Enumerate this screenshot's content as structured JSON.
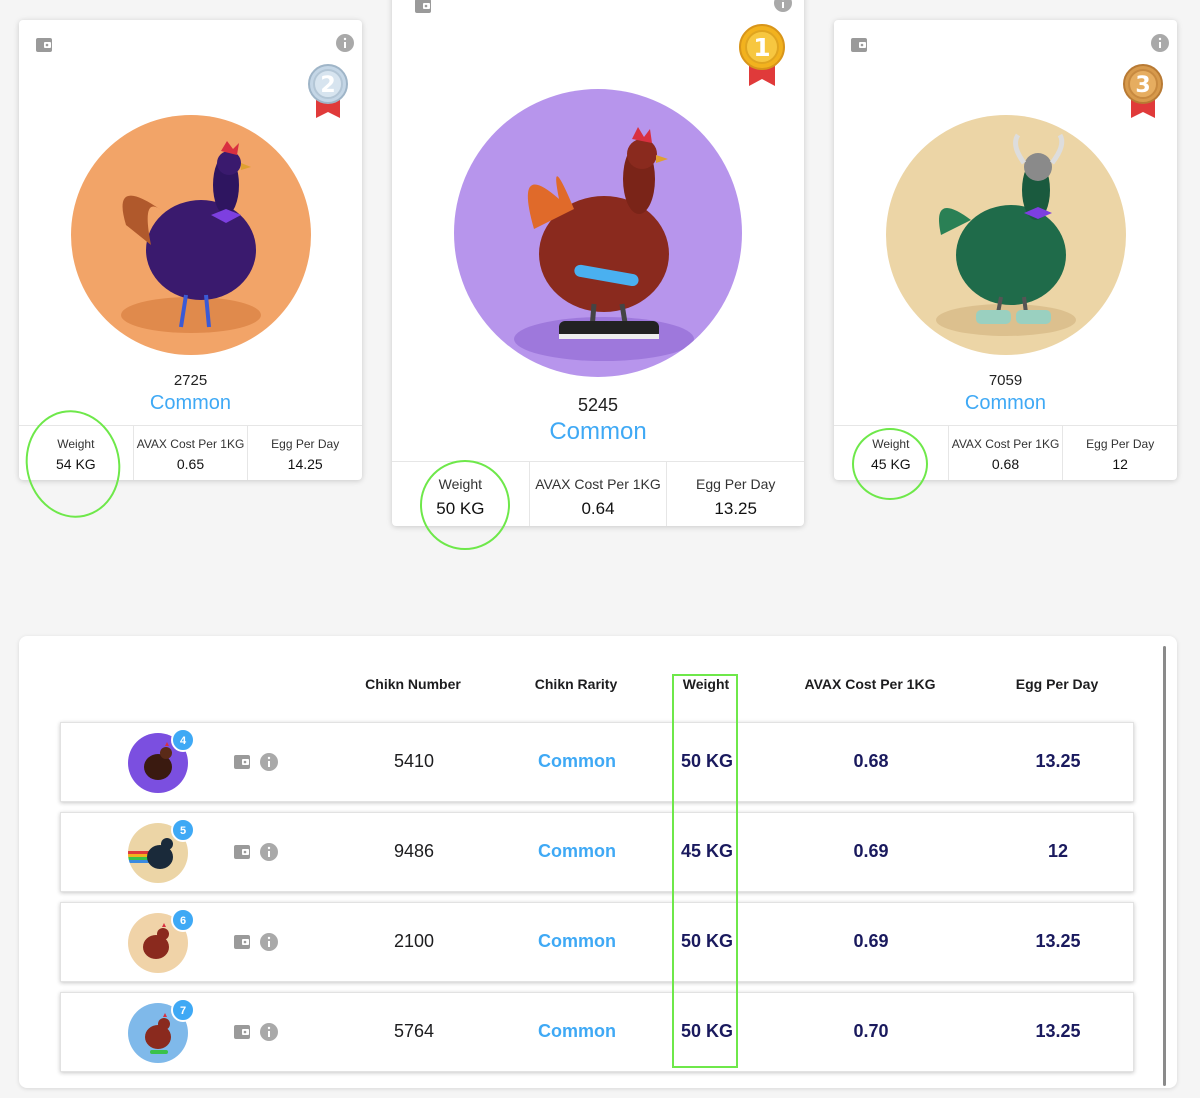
{
  "top_cards": [
    {
      "rank": "2",
      "chikn_number": "2725",
      "rarity": "Common",
      "stats": [
        {
          "label": "Weight",
          "value": "54 KG"
        },
        {
          "label": "AVAX Cost Per 1KG",
          "value": "0.65"
        },
        {
          "label": "Egg Per Day",
          "value": "14.25"
        }
      ],
      "circle_color": "#f2a468",
      "medal_color": "#c4d6e6"
    },
    {
      "rank": "1",
      "chikn_number": "5245",
      "rarity": "Common",
      "stats": [
        {
          "label": "Weight",
          "value": "50 KG"
        },
        {
          "label": "AVAX Cost Per 1KG",
          "value": "0.64"
        },
        {
          "label": "Egg Per Day",
          "value": "13.25"
        }
      ],
      "circle_color": "#b795ec",
      "medal_color": "#f2b21e"
    },
    {
      "rank": "3",
      "chikn_number": "7059",
      "rarity": "Common",
      "stats": [
        {
          "label": "Weight",
          "value": "45 KG"
        },
        {
          "label": "AVAX Cost Per 1KG",
          "value": "0.68"
        },
        {
          "label": "Egg Per Day",
          "value": "12"
        }
      ],
      "circle_color": "#ecd5a6",
      "medal_color": "#d79a4c"
    }
  ],
  "table": {
    "headers": {
      "chikn_number": "Chikn Number",
      "chikn_rarity": "Chikn Rarity",
      "weight": "Weight",
      "avax_cost": "AVAX Cost Per 1KG",
      "egg_per_day": "Egg Per Day"
    },
    "rows": [
      {
        "rank": "4",
        "chikn_number": "5410",
        "rarity": "Common",
        "weight": "50 KG",
        "avax_cost": "0.68",
        "egg_per_day": "13.25",
        "avatar_color": "#7b4fe0"
      },
      {
        "rank": "5",
        "chikn_number": "9486",
        "rarity": "Common",
        "weight": "45 KG",
        "avax_cost": "0.69",
        "egg_per_day": "12",
        "avatar_color": "#ecd5a6"
      },
      {
        "rank": "6",
        "chikn_number": "2100",
        "rarity": "Common",
        "weight": "50 KG",
        "avax_cost": "0.69",
        "egg_per_day": "13.25",
        "avatar_color": "#f0d3a8"
      },
      {
        "rank": "7",
        "chikn_number": "5764",
        "rarity": "Common",
        "weight": "50 KG",
        "avax_cost": "0.70",
        "egg_per_day": "13.25",
        "avatar_color": "#7fb9ea"
      }
    ]
  },
  "colors": {
    "accent_blue": "#3fa9f5",
    "highlight_green": "#6ee84a",
    "dark_value": "#1a1a5e"
  }
}
